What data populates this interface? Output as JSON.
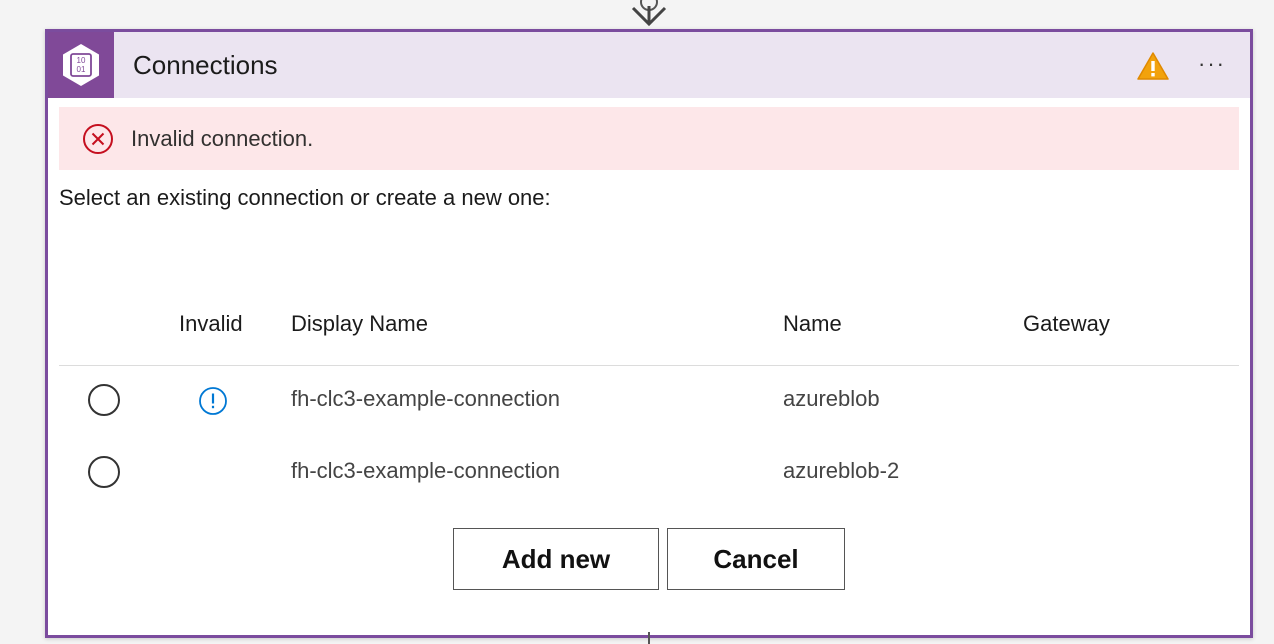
{
  "header": {
    "title": "Connections",
    "icon": "blob-storage-icon",
    "icon_glyph_top": "10",
    "icon_glyph_bottom": "01",
    "warning_icon": "warning-icon",
    "more_label": "···",
    "accent_color": "#804998"
  },
  "error_banner": {
    "message": "Invalid connection.",
    "icon": "error-circle-icon",
    "background": "#fde7e9"
  },
  "prompt": "Select an existing connection or create a new one:",
  "table": {
    "columns": [
      "Invalid",
      "Display Name",
      "Name",
      "Gateway"
    ],
    "rows": [
      {
        "invalid_icon": "info-icon",
        "display_name": "fh-clc3-example-connection",
        "name": "azureblob",
        "gateway": ""
      },
      {
        "invalid_icon": "",
        "display_name": "fh-clc3-example-connection",
        "name": "azureblob-2",
        "gateway": ""
      }
    ]
  },
  "buttons": {
    "add_new": "Add new",
    "cancel": "Cancel"
  }
}
